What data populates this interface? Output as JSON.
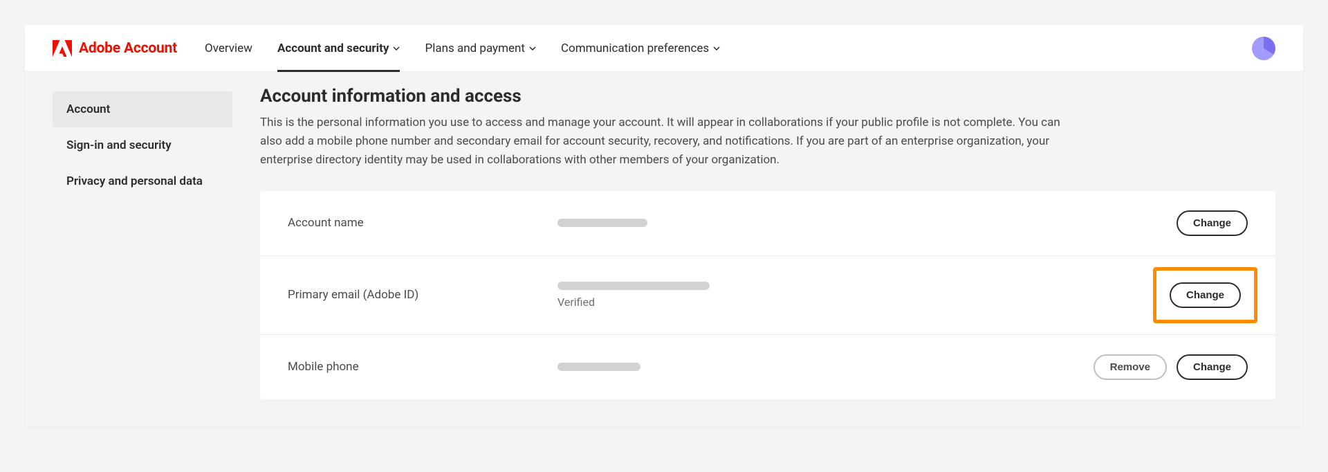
{
  "brand": {
    "text": "Adobe Account"
  },
  "nav": {
    "overview": "Overview",
    "account_security": "Account and security",
    "plans_payment": "Plans and payment",
    "comm_prefs": "Communication preferences"
  },
  "sidebar": {
    "account": "Account",
    "signin": "Sign-in and security",
    "privacy": "Privacy and personal data"
  },
  "title": "Account information and access",
  "desc": "This is the personal information you use to access and manage your account. It will appear in collaborations if your public profile is not complete. You can also add a mobile phone number and secondary email for account security, recovery, and notifications. If you are part of an enterprise organization, your enterprise directory identity may be used in collaborations with other members of your organization.",
  "rows": {
    "account_name": {
      "label": "Account name",
      "change": "Change"
    },
    "primary_email": {
      "label": "Primary email (Adobe ID)",
      "status": "Verified",
      "change": "Change"
    },
    "mobile": {
      "label": "Mobile phone",
      "remove": "Remove",
      "change": "Change"
    }
  }
}
